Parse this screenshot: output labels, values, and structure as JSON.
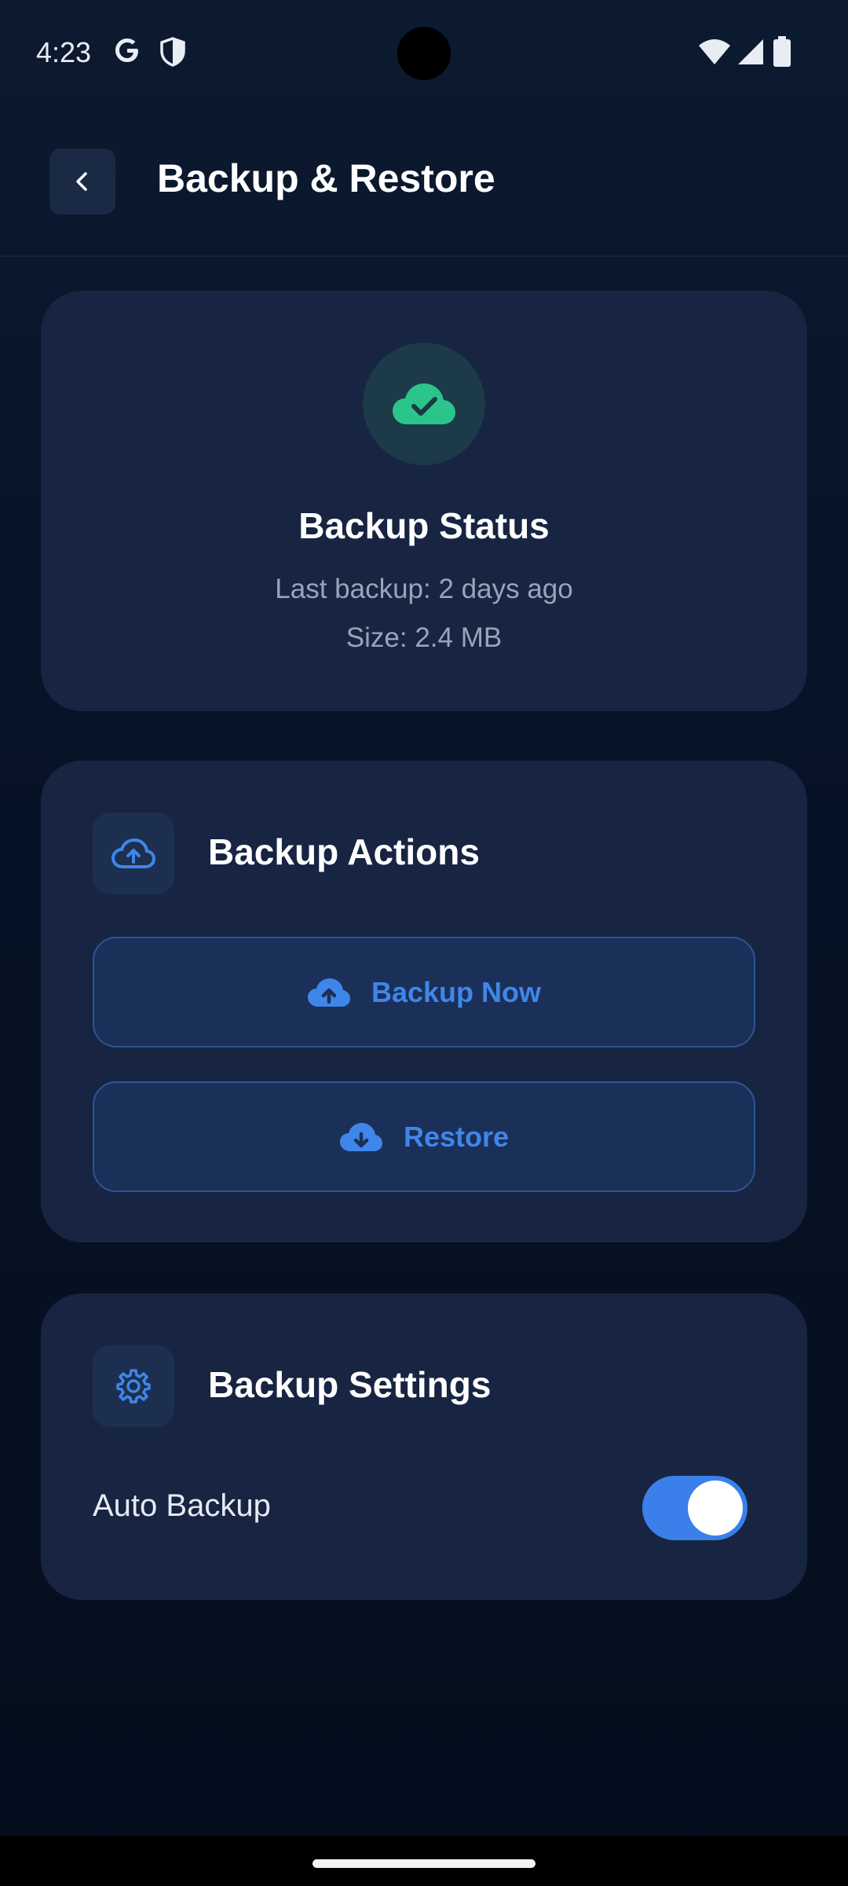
{
  "status_bar": {
    "time": "4:23"
  },
  "header": {
    "title": "Backup & Restore"
  },
  "status_card": {
    "title": "Backup Status",
    "last_backup": "Last backup: 2 days ago",
    "size": "Size: 2.4 MB"
  },
  "actions_card": {
    "title": "Backup Actions",
    "backup_label": "Backup Now",
    "restore_label": "Restore"
  },
  "settings_card": {
    "title": "Backup Settings",
    "auto_backup_label": "Auto Backup",
    "auto_backup_enabled": true
  },
  "colors": {
    "accent": "#3a7fea",
    "success": "#2bc48a",
    "card": "#172542"
  },
  "icons": {
    "back": "chevron-left-icon",
    "status": "cloud-check-icon",
    "actions": "cloud-upload-outline-icon",
    "backup": "cloud-upload-icon",
    "restore": "cloud-download-icon",
    "settings": "gear-icon"
  }
}
